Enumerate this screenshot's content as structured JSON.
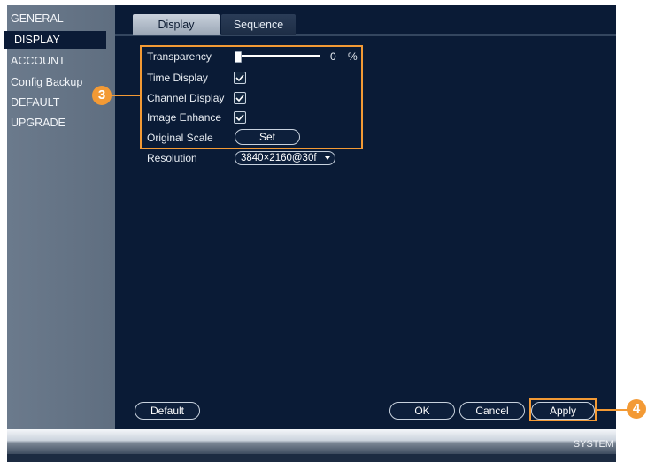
{
  "sidebar": {
    "items": [
      {
        "label": "GENERAL"
      },
      {
        "label": "DISPLAY"
      },
      {
        "label": "ACCOUNT"
      },
      {
        "label": "Config Backup"
      },
      {
        "label": "DEFAULT"
      },
      {
        "label": "UPGRADE"
      }
    ],
    "active": "DISPLAY"
  },
  "tabs": [
    {
      "label": "Display",
      "active": true
    },
    {
      "label": "Sequence",
      "active": false
    }
  ],
  "settings": {
    "transparency": {
      "label": "Transparency",
      "value": "0",
      "unit": "%",
      "slider_fraction": 0
    },
    "time_display": {
      "label": "Time Display",
      "checked": true
    },
    "channel_display": {
      "label": "Channel Display",
      "checked": true
    },
    "image_enhance": {
      "label": "Image Enhance",
      "checked": true
    },
    "original_scale": {
      "label": "Original Scale",
      "button": "Set"
    },
    "resolution": {
      "label": "Resolution",
      "value": "3840×2160@30f"
    }
  },
  "buttons": {
    "default": "Default",
    "ok": "OK",
    "cancel": "Cancel",
    "apply": "Apply"
  },
  "footer": {
    "label": "SYSTEM"
  },
  "callouts": {
    "settings": "3",
    "apply": "4"
  },
  "colors": {
    "accent_orange": "#f39a35",
    "panel_bg": "#0a1b36",
    "sidebar_bg": "#64738a"
  }
}
